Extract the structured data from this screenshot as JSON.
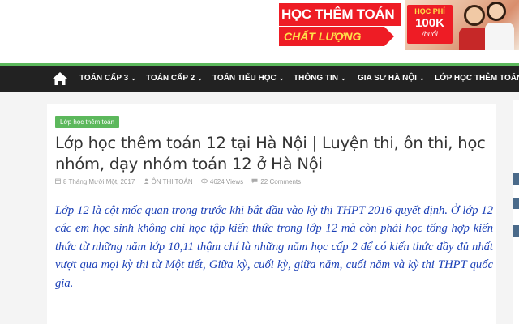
{
  "banner": {
    "title": "HỌC THÊM TOÁN",
    "subtitle": "CHẤT LƯỢNG CAO",
    "price_label": "HỌC PHÍ",
    "price_value": "100K",
    "price_unit": "/buổi",
    "colors": {
      "red": "#ee1c25",
      "yellow": "#ffe14a"
    }
  },
  "nav": {
    "home_icon": "home-icon",
    "items": [
      {
        "label": "TOÁN CẤP 3",
        "caret": "⌄"
      },
      {
        "label": "TOÁN CẤP 2",
        "caret": "⌄"
      },
      {
        "label": "TOÁN TIỂU HỌC",
        "caret": "⌄"
      },
      {
        "label": "THÔNG TIN",
        "caret": "⌄"
      },
      {
        "label": "GIA SƯ HÀ NỘI",
        "caret": "⌄"
      },
      {
        "label": "LỚP HỌC THÊM TOÁN",
        "caret": ""
      }
    ],
    "colors": {
      "background": "#222222",
      "accent": "#5cb85c"
    }
  },
  "post": {
    "category": "Lớp học thêm toán",
    "title": "Lớp học thêm toán 12 tại Hà Nội | Luyện thi, ôn thi, học nhóm, dạy nhóm toán 12 ở Hà Nội",
    "meta": {
      "date": "8 Tháng Mười Một, 2017",
      "author": "ÔN THI TOÁN",
      "views": "4624 Views",
      "comments": "22 Comments"
    },
    "body": "Lớp 12 là cột mốc quan trọng trước khi bắt đầu vào kỳ thi THPT 2016 quyết định. Ở lớp 12 các em học sinh không chỉ học tập kiến thức trong lớp 12 mà còn phải học tổng hợp kiến thức từ những năm lớp 10,11 thậm chí là những năm học cấp 2 để có kiến thức đầy đủ nhất vượt qua mọi kỳ thi từ Một tiết, Giữa kỳ, cuối kỳ, giữa năm, cuối năm và  kỳ thi THPT quốc gia.",
    "body_color": "#1a3fb6"
  }
}
